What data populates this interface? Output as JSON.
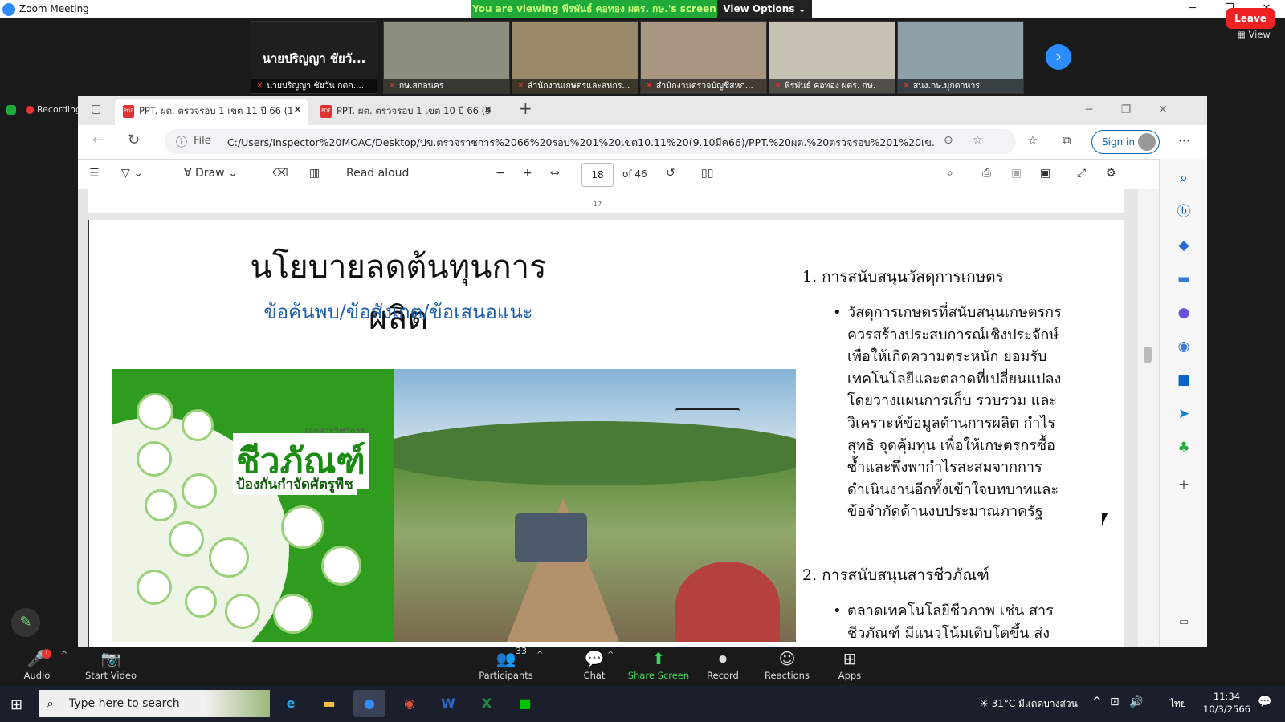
{
  "zoom": {
    "title": "Zoom Meeting",
    "banner_text": "You are viewing พีรพันธ์ คอทอง ผตร. กษ.'s screen",
    "view_options": "View Options",
    "view_label": "View",
    "recording": "Recording",
    "name_tile": {
      "big": "นายปริญญา ชัยวั...",
      "label": "นายปริญญา ชัยวัน กตก...."
    },
    "tiles": [
      "กษ.สกลนคร",
      "สำนักงานเกษตรและสหกร...",
      "สำนักงานตรวจบัญชีสหก...",
      "พีรพันธ์ คอทอง ผตร. กษ.",
      "สนง.กษ.มุกดาหาร"
    ],
    "tile_colors": [
      "#8a8f80",
      "#9a8a6c",
      "#a89582",
      "#c8c2b4",
      "#8fa0a8"
    ],
    "controls": [
      {
        "name": "audio",
        "label": "Audio",
        "icon": "🎤",
        "badge": "!"
      },
      {
        "name": "start-video",
        "label": "Start Video",
        "icon": "📷"
      },
      {
        "name": "participants",
        "label": "Participants",
        "icon": "👥",
        "count": "33"
      },
      {
        "name": "chat",
        "label": "Chat",
        "icon": "💬"
      },
      {
        "name": "share-screen",
        "label": "Share Screen",
        "icon": "⬆"
      },
      {
        "name": "record",
        "label": "Record",
        "icon": "⏺"
      },
      {
        "name": "reactions",
        "label": "Reactions",
        "icon": "☺"
      },
      {
        "name": "apps",
        "label": "Apps",
        "icon": "⊞"
      }
    ],
    "leave": "Leave"
  },
  "browser": {
    "tabs": [
      "PPT. ผต. ตรวจรอบ 1 เขต 11 ปี 66 (1",
      "PPT. ผต. ตรวจรอบ 1 เขต 10 ปี 66 (9"
    ],
    "file_label": "File",
    "url": "C:/Users/Inspector%20MOAC/Desktop/ปข.ตรวจราชการ%2066%20รอบ%201%20เขต10.11%20(9.10มีค66)/PPT.%20ผต.%20ตรวจรอบ%201%20เข...",
    "sign_in": "Sign in",
    "draw": "Draw",
    "read_aloud": "Read aloud",
    "page": "18",
    "of_pages": "of 46",
    "prev_page_num": "17"
  },
  "slide": {
    "title": "นโยบายลดต้นทุนการผลิต",
    "subtitle": "ข้อค้นพบ/ข้อสังเกต/ข้อเสนอแนะ",
    "poster_doc": "เอกสารวิชาการ",
    "poster_big": "ชีวภัณฑ์",
    "poster_small": "ป้องกันกำจัดศัตรูพืช",
    "item1_title": "1.   การสนับสนุนวัสดุการเกษตร",
    "item1_body": "วัสดุการเกษตรที่สนับสนุนเกษตรกร ควรสร้างประสบการณ์เชิงประจักษ์ เพื่อให้เกิดความตระหนัก ยอมรับเทคโนโลยีและตลาดที่เปลี่ยนแปลง โดยวางแผนการเก็บ รวบรวม และวิเคราะห์ข้อมูลด้านการผลิต กำไรสุทธิ จุดคุ้มทุน เพื่อให้เกษตรกรซื้อซ้ำและพึ่งพากำไรสะสมจากการดำเนินงานอีกทั้งเข้าใจบทบาทและข้อจำกัดด้านงบประมาณภาครัฐ",
    "item2_title": "2.   การสนับสนุนสารชีวภัณฑ์",
    "item2_body": "ตลาดเทคโนโลยีชีวภาพ เช่น สารชีวภัณฑ์ มีแนวโน้มเติบโตขึ้น ส่งผล"
  },
  "taskbar": {
    "search_placeholder": "Type here to search",
    "weather": "31°C  มีแดดบางส่วน",
    "ime": "ไทย",
    "time": "11:34",
    "date": "10/3/2566"
  }
}
